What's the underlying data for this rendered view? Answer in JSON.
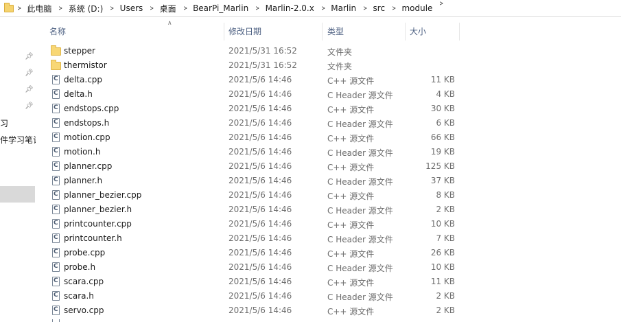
{
  "breadcrumb": [
    "此电脑",
    "系统 (D:)",
    "Users",
    "桌面",
    "BearPi_Marlin",
    "Marlin-2.0.x",
    "Marlin",
    "src",
    "module"
  ],
  "nav_pane": {
    "items": [
      "习",
      "件学习笔记"
    ]
  },
  "columns": {
    "name": "名称",
    "date": "修改日期",
    "type": "类型",
    "size": "大小"
  },
  "files": [
    {
      "name": "stepper",
      "date": "2021/5/31 16:52",
      "type": "文件夹",
      "size": "",
      "icon": "folder-icon"
    },
    {
      "name": "thermistor",
      "date": "2021/5/31 16:52",
      "type": "文件夹",
      "size": "",
      "icon": "folder-icon"
    },
    {
      "name": "delta.cpp",
      "date": "2021/5/6 14:46",
      "type": "C++ 源文件",
      "size": "11 KB",
      "icon": "cpp-file-icon"
    },
    {
      "name": "delta.h",
      "date": "2021/5/6 14:46",
      "type": "C Header 源文件",
      "size": "4 KB",
      "icon": "header-file-icon"
    },
    {
      "name": "endstops.cpp",
      "date": "2021/5/6 14:46",
      "type": "C++ 源文件",
      "size": "30 KB",
      "icon": "cpp-file-icon"
    },
    {
      "name": "endstops.h",
      "date": "2021/5/6 14:46",
      "type": "C Header 源文件",
      "size": "6 KB",
      "icon": "header-file-icon"
    },
    {
      "name": "motion.cpp",
      "date": "2021/5/6 14:46",
      "type": "C++ 源文件",
      "size": "66 KB",
      "icon": "cpp-file-icon"
    },
    {
      "name": "motion.h",
      "date": "2021/5/6 14:46",
      "type": "C Header 源文件",
      "size": "19 KB",
      "icon": "header-file-icon"
    },
    {
      "name": "planner.cpp",
      "date": "2021/5/6 14:46",
      "type": "C++ 源文件",
      "size": "125 KB",
      "icon": "cpp-file-icon"
    },
    {
      "name": "planner.h",
      "date": "2021/5/6 14:46",
      "type": "C Header 源文件",
      "size": "37 KB",
      "icon": "header-file-icon"
    },
    {
      "name": "planner_bezier.cpp",
      "date": "2021/5/6 14:46",
      "type": "C++ 源文件",
      "size": "8 KB",
      "icon": "cpp-file-icon"
    },
    {
      "name": "planner_bezier.h",
      "date": "2021/5/6 14:46",
      "type": "C Header 源文件",
      "size": "2 KB",
      "icon": "header-file-icon"
    },
    {
      "name": "printcounter.cpp",
      "date": "2021/5/6 14:46",
      "type": "C++ 源文件",
      "size": "10 KB",
      "icon": "cpp-file-icon"
    },
    {
      "name": "printcounter.h",
      "date": "2021/5/6 14:46",
      "type": "C Header 源文件",
      "size": "7 KB",
      "icon": "header-file-icon"
    },
    {
      "name": "probe.cpp",
      "date": "2021/5/6 14:46",
      "type": "C++ 源文件",
      "size": "26 KB",
      "icon": "cpp-file-icon"
    },
    {
      "name": "probe.h",
      "date": "2021/5/6 14:46",
      "type": "C Header 源文件",
      "size": "10 KB",
      "icon": "header-file-icon"
    },
    {
      "name": "scara.cpp",
      "date": "2021/5/6 14:46",
      "type": "C++ 源文件",
      "size": "11 KB",
      "icon": "cpp-file-icon"
    },
    {
      "name": "scara.h",
      "date": "2021/5/6 14:46",
      "type": "C Header 源文件",
      "size": "2 KB",
      "icon": "header-file-icon"
    },
    {
      "name": "servo.cpp",
      "date": "2021/5/6 14:46",
      "type": "C++ 源文件",
      "size": "2 KB",
      "icon": "cpp-file-icon"
    }
  ],
  "colors": {
    "header_text": "#4d6082",
    "secondary_text": "#6d6d6d",
    "nav_selection": "#d9d9d9",
    "folder": "#f8d775"
  }
}
